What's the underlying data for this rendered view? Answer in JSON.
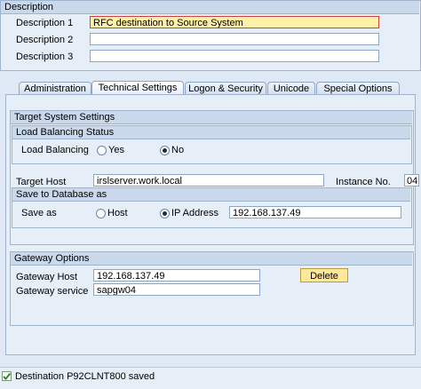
{
  "description": {
    "title": "Description",
    "label1": "Description 1",
    "value1": "RFC destination to Source System",
    "label2": "Description 2",
    "value2": "",
    "label3": "Description 3",
    "value3": ""
  },
  "tabs": [
    "Administration",
    "Technical Settings",
    "Logon & Security",
    "Unicode",
    "Special Options"
  ],
  "target_system": {
    "title": "Target System Settings",
    "lb_status_title": "Load Balancing Status",
    "load_balancing_label": "Load Balancing",
    "yes_label": "Yes",
    "no_label": "No",
    "load_balancing_selected": "No",
    "target_host_label": "Target Host",
    "target_host_value": "irslserver.work.local",
    "instance_label": "Instance No.",
    "instance_value": "04",
    "save_db_title": "Save to Database as",
    "save_as_label": "Save as",
    "host_label": "Host",
    "ip_label": "IP Address",
    "save_as_selected": "IP Address",
    "ip_value": "192.168.137.49"
  },
  "gateway": {
    "title": "Gateway Options",
    "host_label": "Gateway Host",
    "host_value": "192.168.137.49",
    "service_label": "Gateway service",
    "service_value": "sapgw04",
    "delete_label": "Delete"
  },
  "status": {
    "message": "Destination P92CLNT800 saved",
    "color": "#2e8b2e"
  }
}
